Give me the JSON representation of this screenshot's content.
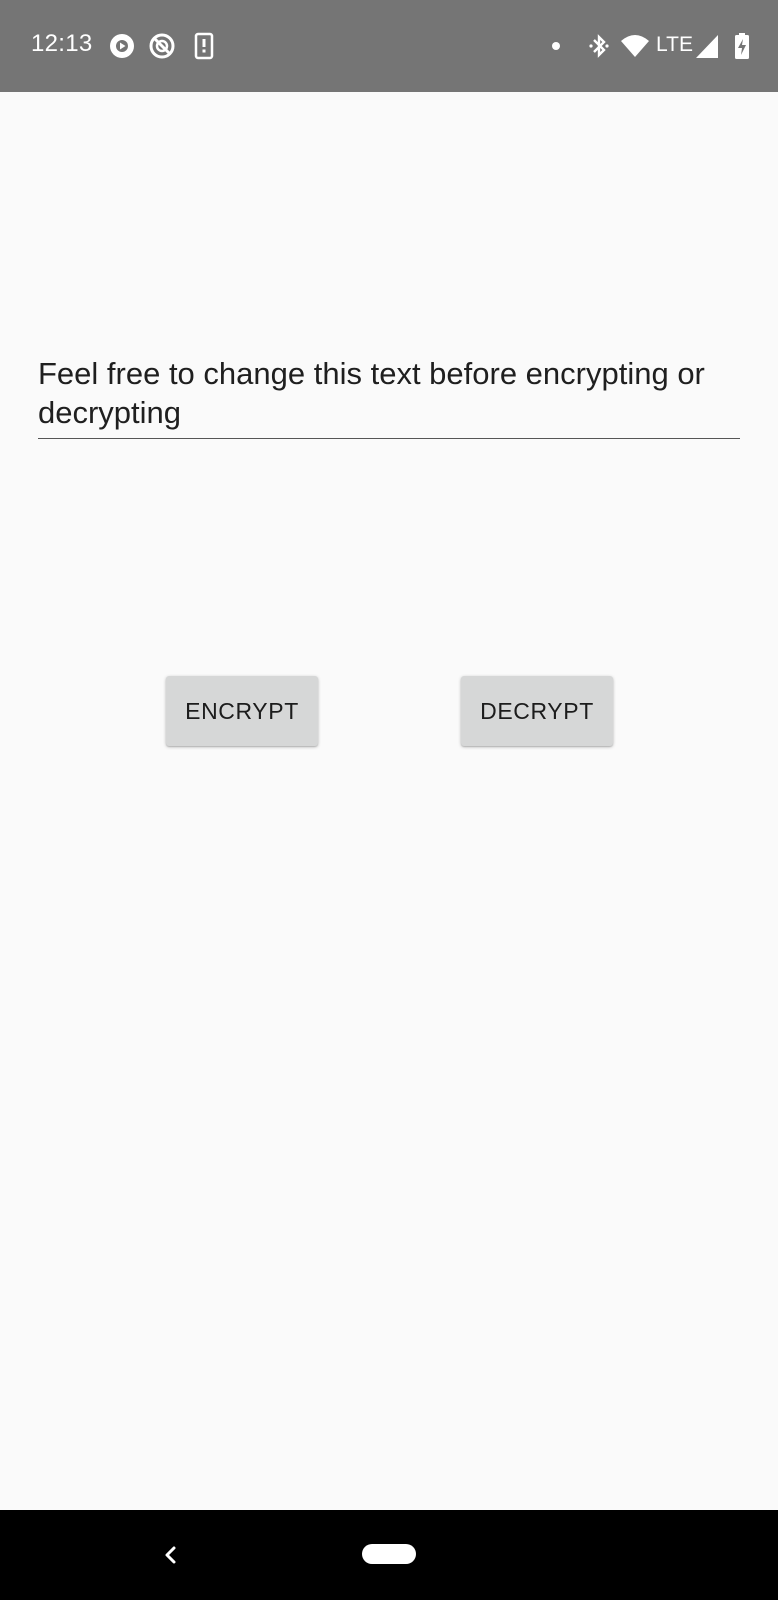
{
  "status_bar": {
    "time": "12:13",
    "network_label": "LTE",
    "icons": [
      "play-circle-icon",
      "do-not-disturb-icon",
      "sim-alert-icon",
      "notification-dot-icon",
      "bluetooth-icon",
      "wifi-icon",
      "signal-icon",
      "battery-charging-icon"
    ]
  },
  "editor": {
    "text": "Feel free to change this text before encrypting or decrypting"
  },
  "actions": {
    "encrypt_label": "ENCRYPT",
    "decrypt_label": "DECRYPT"
  },
  "nav_bar": {
    "icons": [
      "back-icon",
      "home-pill-icon"
    ]
  },
  "colors": {
    "status_bar": "#757575",
    "background": "#fafafa",
    "button": "#d6d7d7",
    "nav_bar": "#000000"
  }
}
